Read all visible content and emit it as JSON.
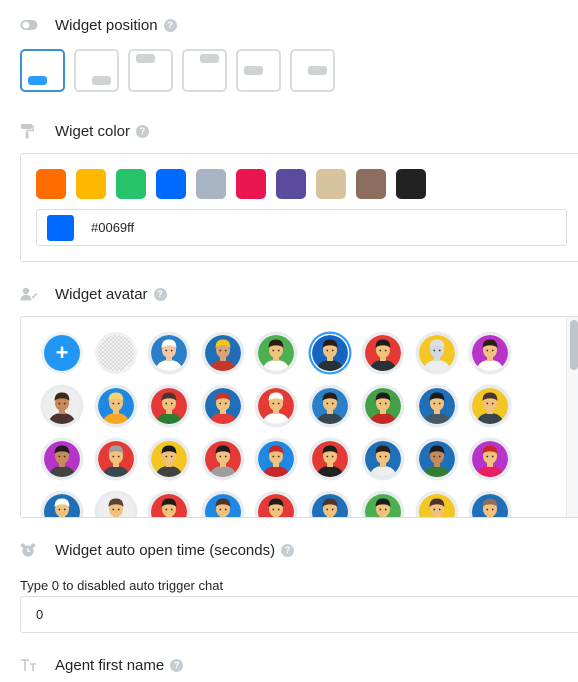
{
  "sections": {
    "position": {
      "title": "Widget position",
      "icon": "toggle-icon"
    },
    "color": {
      "title": "Wiget color",
      "icon": "paint-roller-icon"
    },
    "avatar": {
      "title": "Widget avatar",
      "icon": "user-edit-icon"
    },
    "auto_open": {
      "title": "Widget auto open time (seconds)",
      "icon": "alarm-clock-icon"
    },
    "agent_name": {
      "title": "Agent first name",
      "icon": "text-size-icon"
    }
  },
  "help_glyph": "?",
  "positions": [
    {
      "id": "bottom-left",
      "selected": true
    },
    {
      "id": "bottom-right",
      "selected": false
    },
    {
      "id": "top-left",
      "selected": false
    },
    {
      "id": "top-right",
      "selected": false
    },
    {
      "id": "middle-left",
      "selected": false
    },
    {
      "id": "middle-right",
      "selected": false
    }
  ],
  "color_swatches": [
    "#ff6d00",
    "#ffb800",
    "#27c36a",
    "#0069ff",
    "#a9b4c2",
    "#eb1551",
    "#5a4b9e",
    "#d8c39f",
    "#8c6d5e",
    "#222222"
  ],
  "selected_color": "#0069ff",
  "hex_value": "#0069ff",
  "avatar_add_glyph": "+",
  "auto_open_hint": "Type 0 to disabled auto trigger chat",
  "auto_open_value": "0",
  "avatars": [
    {
      "type": "add",
      "bg": "#2196f3"
    },
    {
      "type": "empty",
      "bg": "#e8e8e8"
    },
    {
      "type": "person",
      "bg": "#2a7fc9",
      "skin": "#f3c9a2",
      "hair": "#ffffff",
      "shirt": "#ffffff"
    },
    {
      "type": "person",
      "bg": "#1e6fb8",
      "skin": "#d9a479",
      "hair": "#f5c518",
      "shirt": "#c0392b"
    },
    {
      "type": "person",
      "bg": "#4caf50",
      "skin": "#f1c27d",
      "hair": "#2b1d14",
      "shirt": "#ffffff"
    },
    {
      "type": "person",
      "bg": "#1565c0",
      "skin": "#f1c27d",
      "hair": "#2b1d14",
      "shirt": "#263238",
      "selected": true
    },
    {
      "type": "person",
      "bg": "#e53935",
      "skin": "#f1c27d",
      "hair": "#1c1c1c",
      "shirt": "#263238"
    },
    {
      "type": "person",
      "bg": "#f3c623",
      "skin": "#d0d8e0",
      "hair": "#e0e0e0",
      "shirt": "#eceff1"
    },
    {
      "type": "person",
      "bg": "#b833c9",
      "skin": "#f1c27d",
      "hair": "#2b1d14",
      "shirt": "#ffffff"
    },
    {
      "type": "person",
      "bg": "#eeeeee",
      "skin": "#c68a5a",
      "hair": "#3b2a1a",
      "shirt": "#4e342e"
    },
    {
      "type": "person",
      "bg": "#1e88e5",
      "skin": "#f1c27d",
      "hair": "#f5d76e",
      "shirt": "#f5a623"
    },
    {
      "type": "person",
      "bg": "#e53935",
      "skin": "#f1c27d",
      "hair": "#4e342e",
      "shirt": "#2e7d32"
    },
    {
      "type": "person",
      "bg": "#1e6fb8",
      "skin": "#f1c27d",
      "hair": "#c0392b",
      "shirt": "#e53935"
    },
    {
      "type": "person",
      "bg": "#e53935",
      "skin": "#f1c27d",
      "hair": "#ffffff",
      "shirt": "#ffffff"
    },
    {
      "type": "person",
      "bg": "#2a7fc9",
      "skin": "#f1c27d",
      "hair": "#2b1d14",
      "shirt": "#37474f"
    },
    {
      "type": "person",
      "bg": "#43a047",
      "skin": "#f1c27d",
      "hair": "#1c1c1c",
      "shirt": "#c62828"
    },
    {
      "type": "person",
      "bg": "#1e6fb8",
      "skin": "#f1c27d",
      "hair": "#1c1c1c",
      "shirt": "#455a64"
    },
    {
      "type": "person",
      "bg": "#f3c623",
      "skin": "#f1c27d",
      "hair": "#4e342e",
      "shirt": "#37474f"
    },
    {
      "type": "person",
      "bg": "#b833c9",
      "skin": "#c68a5a",
      "hair": "#1c1c1c",
      "shirt": "#424242"
    },
    {
      "type": "person",
      "bg": "#e53935",
      "skin": "#f1c27d",
      "hair": "#9e9e9e",
      "shirt": "#37474f"
    },
    {
      "type": "person",
      "bg": "#f3c623",
      "skin": "#f1c27d",
      "hair": "#1c1c1c",
      "shirt": "#424242"
    },
    {
      "type": "person",
      "bg": "#e53935",
      "skin": "#f1c27d",
      "hair": "#1c1c1c",
      "shirt": "#9e9e9e"
    },
    {
      "type": "person",
      "bg": "#1e88e5",
      "skin": "#f1c27d",
      "hair": "#c62828",
      "shirt": "#c62828"
    },
    {
      "type": "person",
      "bg": "#e53935",
      "skin": "#f1c27d",
      "hair": "#1c1c1c",
      "shirt": "#212121"
    },
    {
      "type": "person",
      "bg": "#1e6fb8",
      "skin": "#f1c27d",
      "hair": "#2b1d14",
      "shirt": "#eceff1"
    },
    {
      "type": "person",
      "bg": "#1e6fb8",
      "skin": "#c68a5a",
      "hair": "#1c1c1c",
      "shirt": "#2e7d32"
    },
    {
      "type": "person",
      "bg": "#b833c9",
      "skin": "#f1c27d",
      "hair": "#c62828",
      "shirt": "#e91e63"
    },
    {
      "type": "person",
      "bg": "#1e6fb8",
      "skin": "#f1c27d",
      "hair": "#ffffff",
      "shirt": "#ffffff"
    },
    {
      "type": "person",
      "bg": "#eeeeee",
      "skin": "#f1c27d",
      "hair": "#5d4037",
      "shirt": "#5d4037"
    },
    {
      "type": "person",
      "bg": "#e53935",
      "skin": "#f1c27d",
      "hair": "#1c1c1c",
      "shirt": "#212121"
    },
    {
      "type": "person",
      "bg": "#1e88e5",
      "skin": "#f1c27d",
      "hair": "#4e342e",
      "shirt": "#37474f"
    },
    {
      "type": "person",
      "bg": "#e53935",
      "skin": "#f1c27d",
      "hair": "#1c1c1c",
      "shirt": "#212121"
    },
    {
      "type": "person",
      "bg": "#1e6fb8",
      "skin": "#f1c27d",
      "hair": "#4e342e",
      "shirt": "#37474f"
    },
    {
      "type": "person",
      "bg": "#4caf50",
      "skin": "#f1c27d",
      "hair": "#1c1c1c",
      "shirt": "#ffffff"
    },
    {
      "type": "person",
      "bg": "#f3c623",
      "skin": "#f1c27d",
      "hair": "#4e342e",
      "shirt": "#37474f"
    },
    {
      "type": "person",
      "bg": "#1e6fb8",
      "skin": "#f1c27d",
      "hair": "#8d6e63",
      "shirt": "#37474f"
    }
  ]
}
